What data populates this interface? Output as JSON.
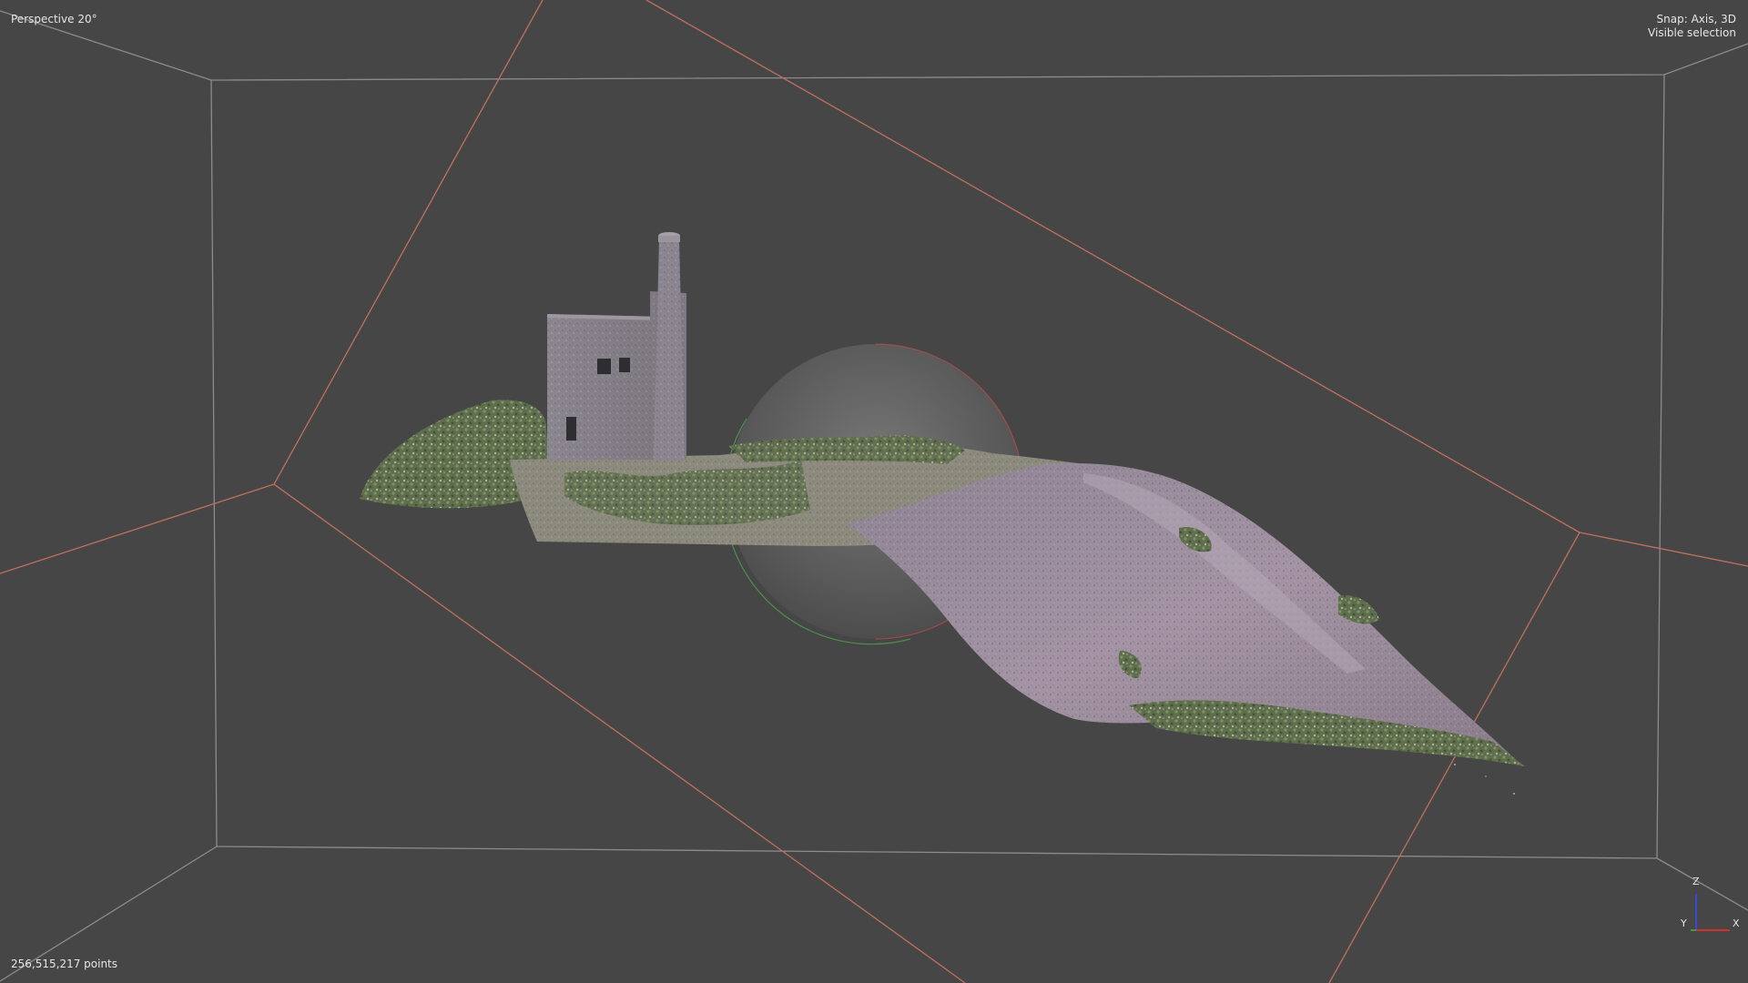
{
  "viewport": {
    "view_label": "Perspective 20°",
    "snap_mode": "Snap: Axis, 3D",
    "selection_mode": "Visible selection",
    "point_count": "256,515,217 points"
  },
  "axis_gizmo": {
    "z_label": "Z",
    "y_label": "Y",
    "x_label": "X"
  },
  "icons": {
    "orbit_sphere": "orbit-sphere-icon",
    "axis_gizmo": "axis-gizmo-icon"
  },
  "colors": {
    "background": "#464646",
    "clip_box_edges": "#8c8c8c",
    "section_plane_edges": "#c0705e",
    "axis_x": "#d03030",
    "axis_y": "#3aa03a",
    "axis_z": "#3a4ad0",
    "text": "#e6e6e6"
  }
}
